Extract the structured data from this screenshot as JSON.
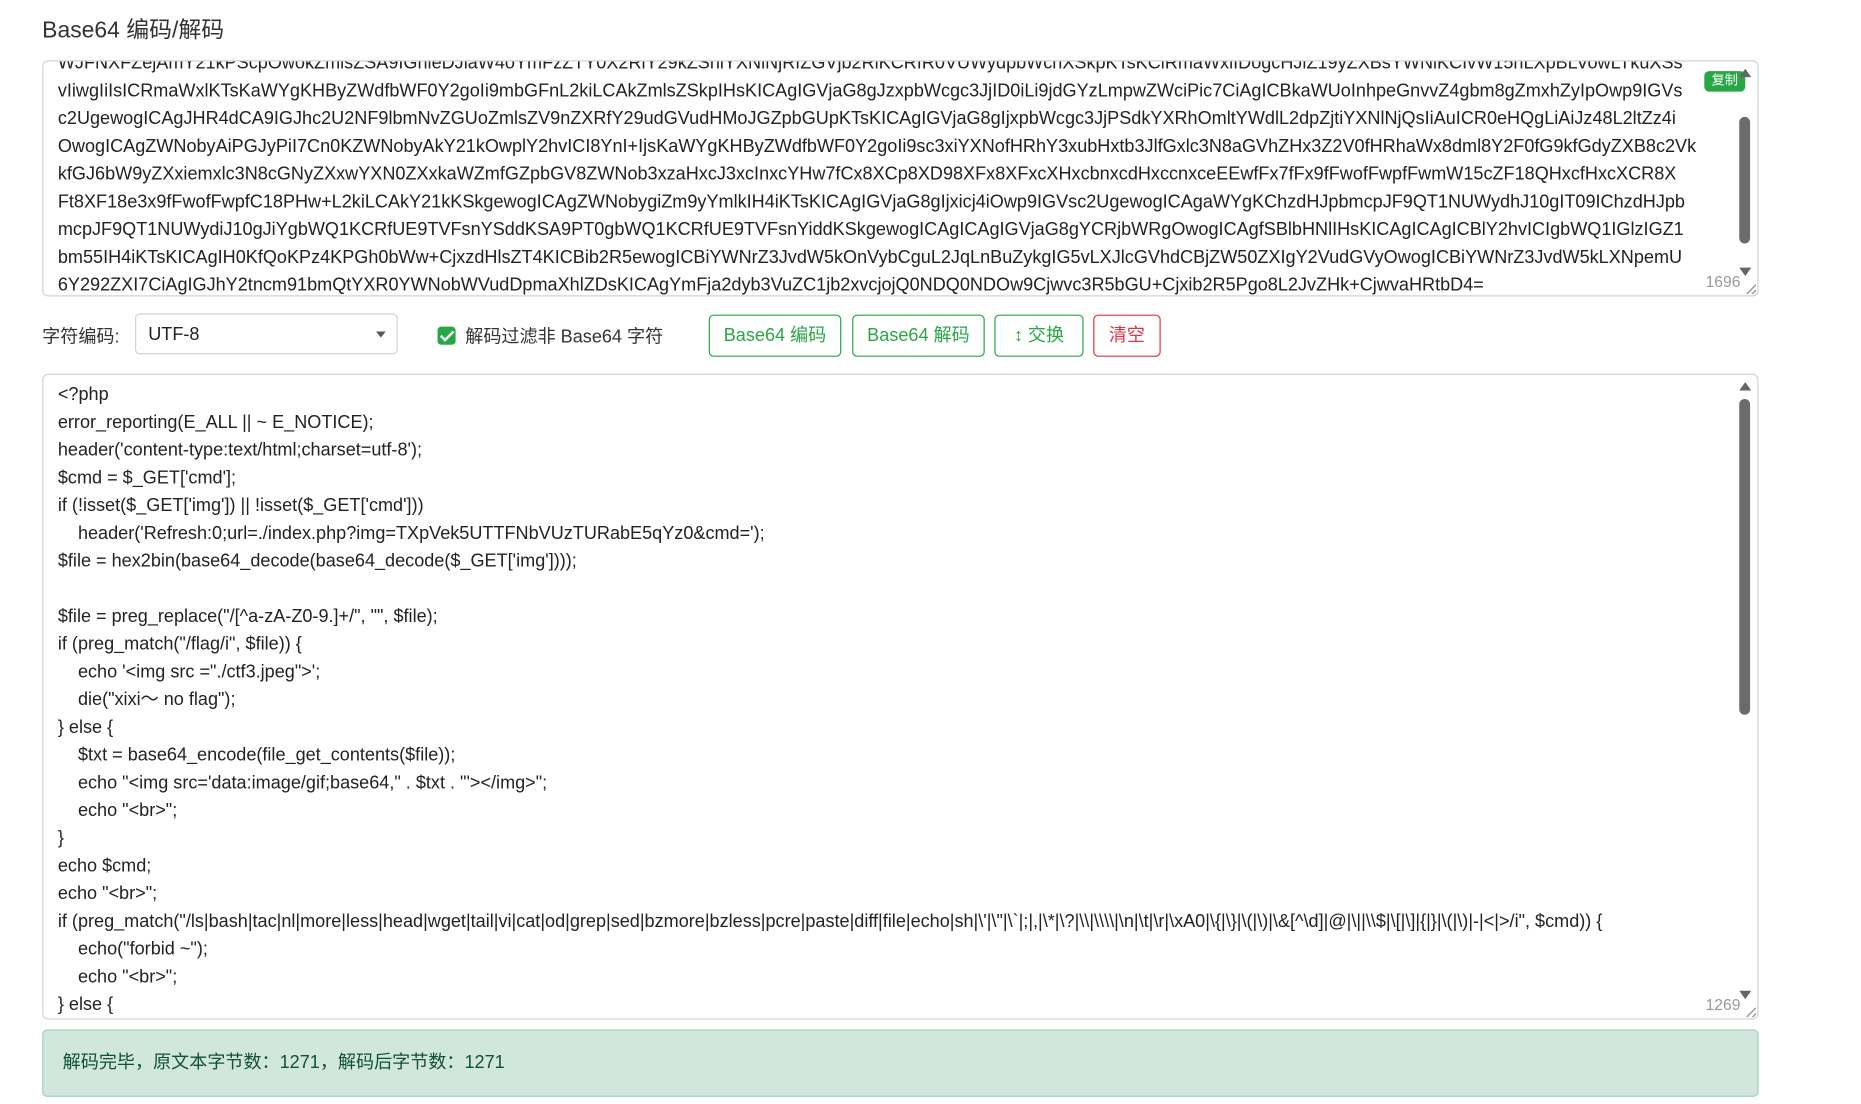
{
  "page": {
    "title": "Base64 编码/解码"
  },
  "input": {
    "lines": [
      "WJFNXFZejAmY21kPScpOwokZmlsZSA9IGhleDJiaW4oYmFzZTY0X2RlY29kZShiYXNlNjRfZGVjb2RlKCRfR0VUWydpbWcnXSkpKTsKCiRmaWxlIDogcHJlZ19yZXBsYWNlKCIvW15hLXpBLVowLTkuXSs",
      "vIiwgIiIsICRmaWxlKTsKaWYgKHByZWdfbWF0Y2goIi9mbGFnL2kiLCAkZmlsZSkpIHsKICAgIGVjaG8gJzxpbWcgc3JjID0iLi9jdGYzLmpwZWciPic7CiAgICBkaWUoInhpeGnvvZ4gbm8gZmxhZyIpOwp9IGVs",
      "c2UgewogICAgJHR4dCA9IGJhc2U2NF9lbmNvZGUoZmlsZV9nZXRfY29udGVudHMoJGZpbGUpKTsKICAgIGVjaG8gIjxpbWcgc3JjPSdkYXRhOmltYWdlL2dpZjtiYXNlNjQsIiAuICR0eHQgLiAiJz48L2ltZz4i",
      "OwogICAgZWNobyAiPGJyPiI7Cn0KZWNobyAkY21kOwplY2hvICI8YnI+IjsKaWYgKHByZWdfbWF0Y2goIi9sc3xiYXNofHRhY3xubHxtb3JlfGxlc3N8aGVhZHx3Z2V0fHRhaWx8dml8Y2F0fG9kfGdyZXB8c2Vk",
      "kfGJ6bW9yZXxiemxlc3N8cGNyZXxwYXN0ZXxkaWZmfGZpbGV8ZWNob3xzaHxcJ3xcInxcYHw7fCx8XCp8XD98XFx8XFxcXHxcbnxcdHxccnxceEEwfFx7fFx9fFwofFwpfFwmW15cZF18QHxcfHxcXCR8X",
      "Ft8XF18e3x9fFwofFwpfC18PHw+L2kiLCAkY21kKSkgewogICAgZWNobygiZm9yYmlkIH4iKTsKICAgIGVjaG8gIjxicj4iOwp9IGVsc2UgewogICAgaWYgKChzdHJpbmcpJF9QT1NUWydhJ10gIT09IChzdHJpb",
      "mcpJF9QT1NUWydiJ10gJiYgbWQ1KCRfUE9TVFsnYSddKSA9PT0gbWQ1KCRfUE9TVFsnYiddKSkgewogICAgICAgIGVjaG8gYCRjbWRgOwogICAgfSBlbHNlIHsKICAgICAgICBlY2hvICIgbWQ1IGlzIGZ1",
      "bm55IH4iKTsKICAgIH0KfQoKPz4KPGh0bWw+CjxzdHlsZT4KICBib2R5ewogICBiYWNrZ3JvdW5kOnVybCguL2JqLnBuZykgIG5vLXJlcGVhdCBjZW50ZXIgY2VudGVyOwogICBiYWNrZ3JvdW5kLXNpemU",
      "6Y292ZXI7CiAgIGJhY2tncm91bmQtYXR0YWNobWVudDpmaXhlZDsKICAgYmFja2dyb3VuZC1jb2xvcjojQ0NDQ0NDOw9Cjwvc3R5bGU+Cjxib2R5Pgo8L2JvZHk+CjwvaHRtbD4="
    ],
    "count": "1696",
    "copy_label": "复制"
  },
  "toolbar": {
    "charset_label": "字符编码:",
    "charset_value": "UTF-8",
    "filter_label": "解码过滤非 Base64 字符",
    "encode_label": "Base64 编码",
    "decode_label": "Base64 解码",
    "swap_label": "↕ 交换",
    "clear_label": "清空"
  },
  "output": {
    "lines": [
      "<?php",
      "error_reporting(E_ALL || ~ E_NOTICE);",
      "header('content-type:text/html;charset=utf-8');",
      "$cmd = $_GET['cmd'];",
      "if (!isset($_GET['img']) || !isset($_GET['cmd']))",
      "    header('Refresh:0;url=./index.php?img=TXpVek5UTTFNbVUzTURabE5qYz0&cmd=');",
      "$file = hex2bin(base64_decode(base64_decode($_GET['img'])));",
      "",
      "$file = preg_replace(\"/[^a-zA-Z0-9.]+/\", \"\", $file);",
      "if (preg_match(\"/flag/i\", $file)) {",
      "    echo '<img src =\"./ctf3.jpeg\">';",
      "    die(\"xixi～ no flag\");",
      "} else {",
      "    $txt = base64_encode(file_get_contents($file));",
      "    echo \"<img src='data:image/gif;base64,\" . $txt . \"'></img>\";",
      "    echo \"<br>\";",
      "}",
      "echo $cmd;",
      "echo \"<br>\";",
      "if (preg_match(\"/ls|bash|tac|nl|more|less|head|wget|tail|vi|cat|od|grep|sed|bzmore|bzless|pcre|paste|diff|file|echo|sh|\\'|\\\"|\\`|;|,|\\*|\\?|\\\\|\\\\\\\\|\\n|\\t|\\r|\\xA0|\\{|\\}|\\(|\\)|\\&[^\\d]|@|\\||\\\\$|\\[|\\]|{|}|\\(|\\)|-|<|>/i\", $cmd)) {",
      "    echo(\"forbid ~\");",
      "    echo \"<br>\";",
      "} else {"
    ],
    "count": "1269"
  },
  "status": {
    "message": "解码完毕，原文本字节数：1271，解码后字节数：1271"
  },
  "colors": {
    "accent": "#28a745",
    "danger": "#dc3545",
    "alert_bg": "#d1e7dd"
  }
}
